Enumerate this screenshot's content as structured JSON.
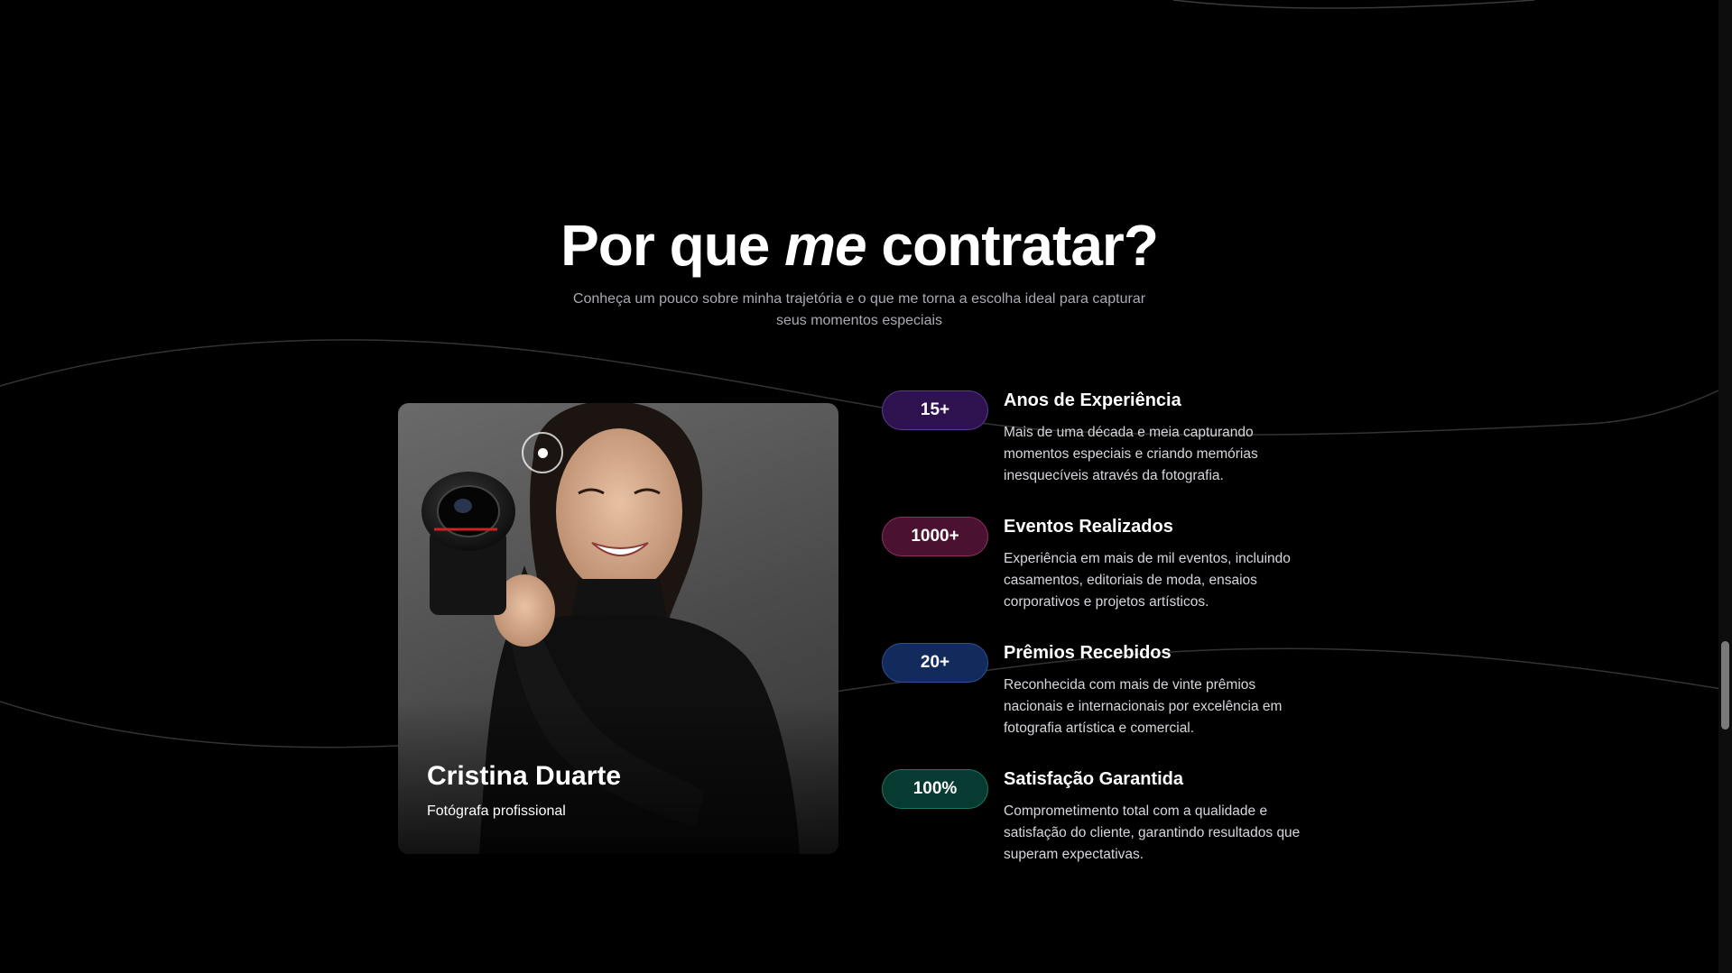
{
  "section": {
    "title_parts": [
      "Por que",
      "me",
      "contratar?"
    ],
    "subtitle": "Conheça um pouco sobre minha trajetória e o que me torna a escolha ideal para capturar seus momentos especiais"
  },
  "profile": {
    "name": "Cristina Duarte",
    "role": "Fotógrafa profissional"
  },
  "features": [
    {
      "badge": "15+",
      "title": "Anos de Experiência",
      "description": "Mais de uma década e meia capturando momentos especiais e criando memórias inesquecíveis através da fotografia."
    },
    {
      "badge": "1000+",
      "title": "Eventos Realizados",
      "description": "Experiência em mais de mil eventos, incluindo casamentos, editoriais de moda, ensaios corporativos e projetos artísticos."
    },
    {
      "badge": "20+",
      "title": "Prêmios Recebidos",
      "description": "Reconhecida com mais de vinte prêmios nacionais e internacionais por excelência em fotografia artística e comercial."
    },
    {
      "badge": "100%",
      "title": "Satisfação Garantida",
      "description": "Comprometimento total com a qualidade e satisfação do cliente, garantindo resultados que superam expectativas."
    }
  ],
  "colors": {
    "background": "#000000",
    "subtitle": "#a9a9b4",
    "badge_purple": "#2e1250",
    "badge_magenta": "#4a1131",
    "badge_blue": "#122a5c",
    "badge_teal": "#073a31"
  }
}
